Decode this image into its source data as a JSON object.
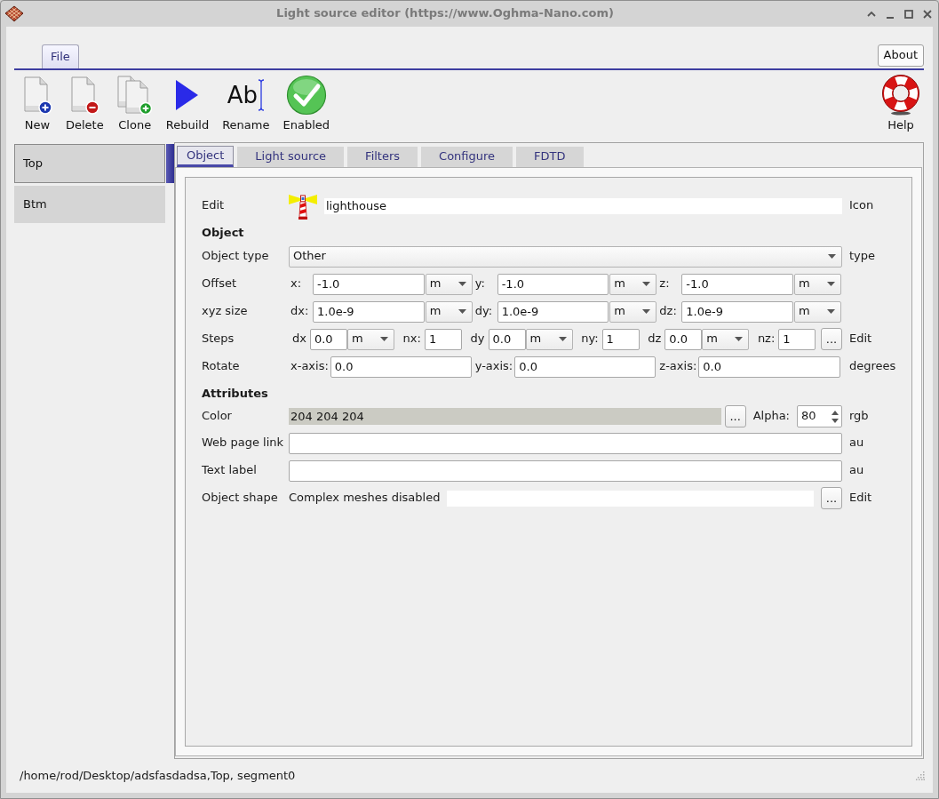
{
  "window": {
    "title": "Light source editor (https://www.Oghma-Nano.com)"
  },
  "ribbon": {
    "tabs": [
      {
        "label": "File",
        "selected": true
      }
    ],
    "about_button": "About"
  },
  "toolbar": {
    "items": [
      {
        "kind": "new",
        "label": "New"
      },
      {
        "kind": "delete",
        "label": "Delete"
      },
      {
        "kind": "clone",
        "label": "Clone"
      },
      {
        "kind": "rebuild",
        "label": "Rebuild"
      },
      {
        "kind": "rename",
        "label": "Rename",
        "glyph": "Ab"
      },
      {
        "kind": "enabled",
        "label": "Enabled"
      }
    ],
    "help": {
      "label": "Help"
    }
  },
  "sidebar": {
    "items": [
      {
        "label": "Top",
        "selected": true
      },
      {
        "label": "Btm",
        "selected": false
      }
    ]
  },
  "tabs": [
    {
      "label": "Object",
      "selected": true
    },
    {
      "label": "Light source",
      "selected": false
    },
    {
      "label": "Filters",
      "selected": false
    },
    {
      "label": "Configure",
      "selected": false
    },
    {
      "label": "FDTD",
      "selected": false
    }
  ],
  "form": {
    "rows": [
      {
        "kind": "icon_field",
        "label": "Edit",
        "value": "lighthouse",
        "unit": "Icon"
      },
      {
        "kind": "heading",
        "label": "Object"
      },
      {
        "kind": "select",
        "label": "Object type",
        "value": "Other",
        "unit": "type"
      },
      {
        "kind": "fields",
        "label": "Offset",
        "fields": [
          {
            "label": "x:",
            "value": "-1.0",
            "unit": "m"
          },
          {
            "label": "y:",
            "value": "-1.0",
            "unit": "m"
          },
          {
            "label": "z:",
            "value": "-1.0",
            "unit": "m"
          }
        ]
      },
      {
        "kind": "fields",
        "label": "xyz size",
        "fields": [
          {
            "label": "dx:",
            "value": "1.0e-9",
            "unit": "m"
          },
          {
            "label": "dy:",
            "value": "1.0e-9",
            "unit": "m"
          },
          {
            "label": "dz:",
            "value": "1.0e-9",
            "unit": "m"
          }
        ]
      },
      {
        "kind": "steps",
        "label": "Steps",
        "fields": [
          {
            "label": "dx",
            "value": "0.0",
            "unit": "m"
          },
          {
            "label": "nx:",
            "value": "1"
          },
          {
            "label": "dy",
            "value": "0.0",
            "unit": "m"
          },
          {
            "label": "ny:",
            "value": "1"
          },
          {
            "label": "dz",
            "value": "0.0",
            "unit": "m"
          },
          {
            "label": "nz:",
            "value": "1"
          }
        ],
        "button": "...",
        "unit": "Edit"
      },
      {
        "kind": "fields",
        "label": "Rotate",
        "fields": [
          {
            "label": "x-axis:",
            "value": "0.0"
          },
          {
            "label": "y-axis:",
            "value": "0.0"
          },
          {
            "label": "z-axis:",
            "value": "0.0"
          }
        ],
        "unit": "degrees"
      },
      {
        "kind": "heading",
        "label": "Attributes"
      },
      {
        "kind": "color",
        "label": "Color",
        "value": "204 204 204",
        "button": "...",
        "alpha_label": "Alpha:",
        "alpha": "80",
        "unit": "rgb"
      },
      {
        "kind": "text",
        "label": "Web page link",
        "unit": "au"
      },
      {
        "kind": "text",
        "label": "Text label",
        "unit": "au"
      },
      {
        "kind": "shape",
        "label": "Object shape",
        "note": "Complex meshes disabled",
        "button": "...",
        "unit": "Edit"
      }
    ]
  },
  "status_bar": {
    "text": "/home/rod/Desktop/adsfasdadsa,Top, segment0"
  }
}
